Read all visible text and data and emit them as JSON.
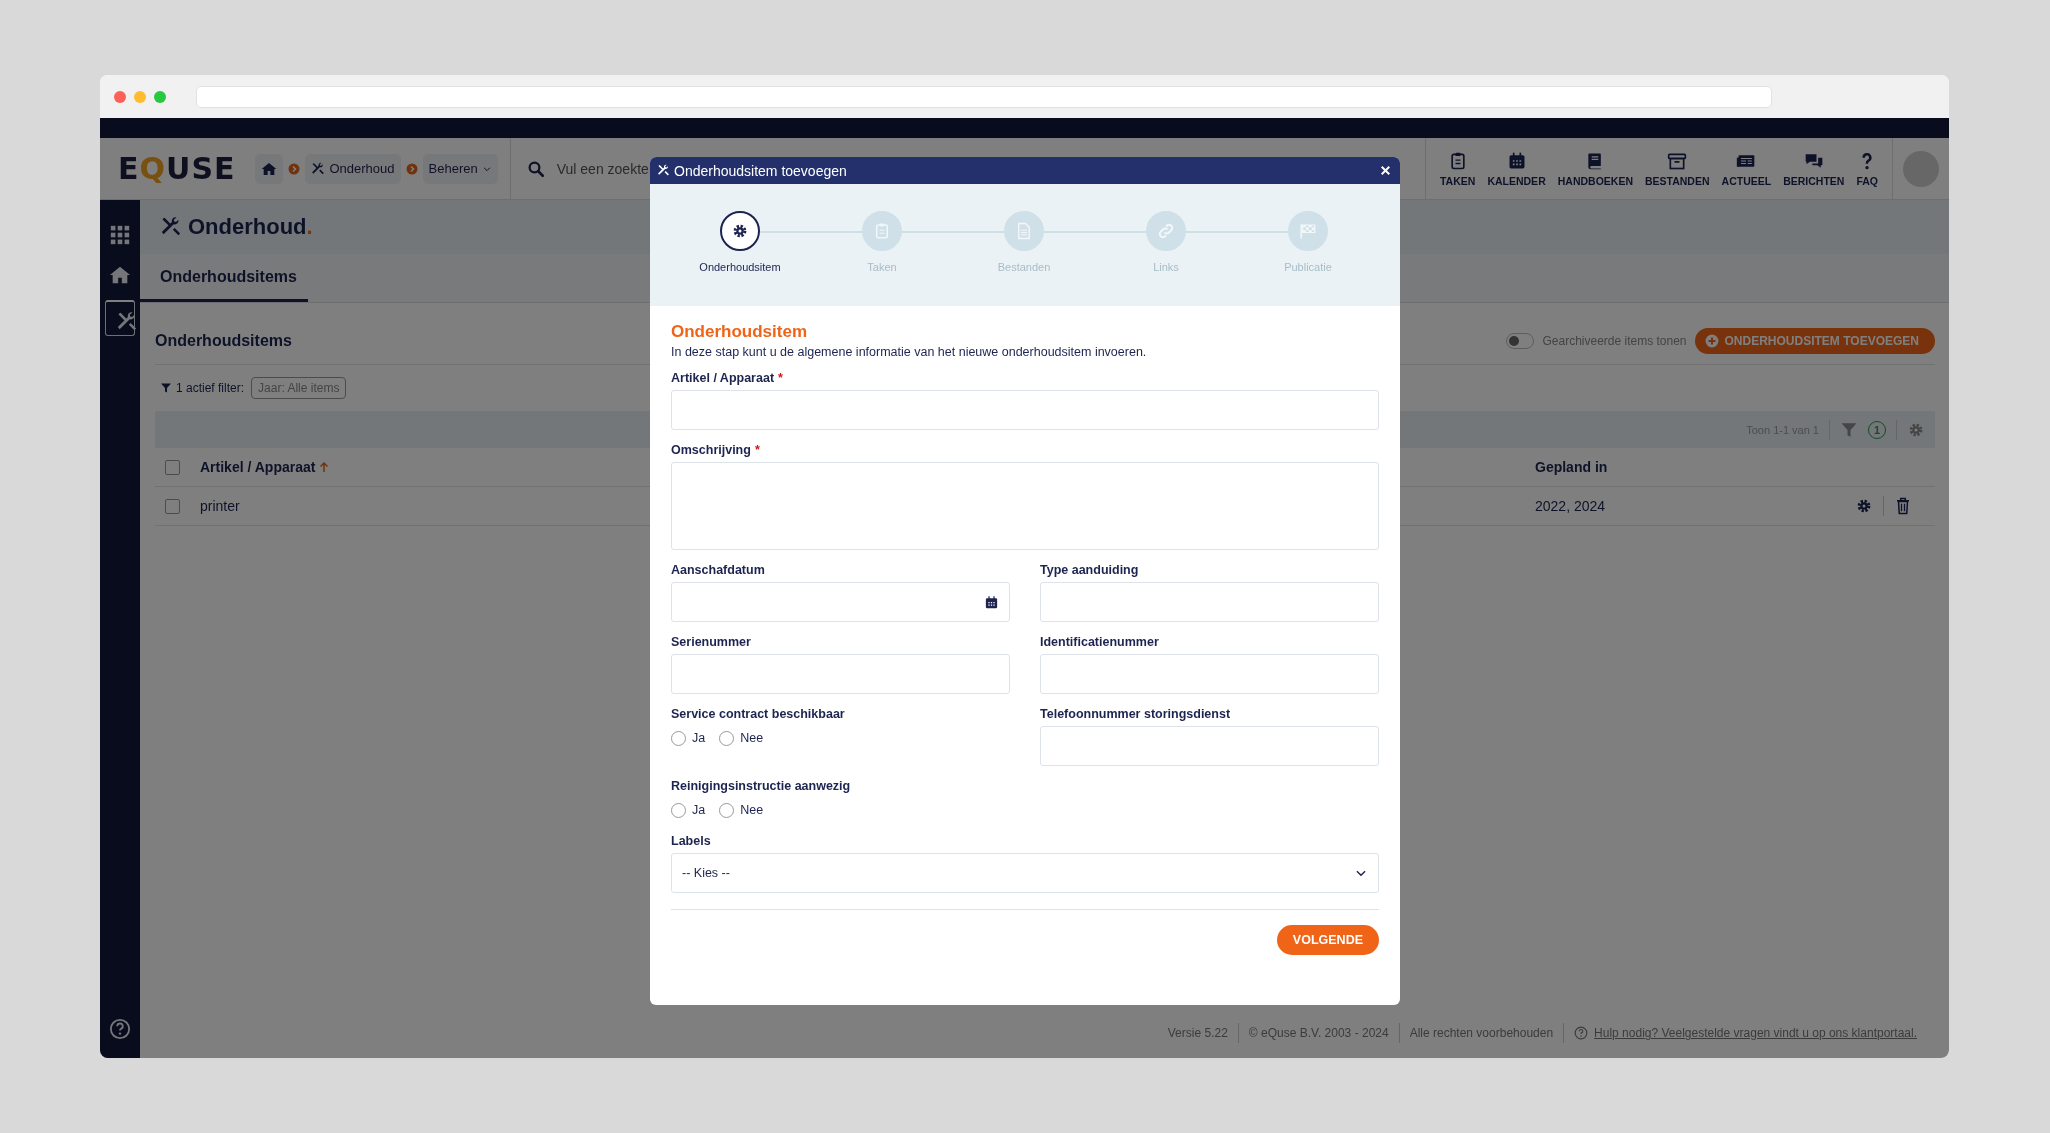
{
  "header": {
    "logo": [
      {
        "text": "E",
        "accent": false
      },
      {
        "text": "Q",
        "accent": true
      },
      {
        "text": "USE",
        "accent": false
      }
    ],
    "breadcrumbs": [
      {
        "kind": "home"
      },
      {
        "kind": "section",
        "label": "Onderhoud"
      },
      {
        "kind": "dropdown",
        "label": "Beheren"
      }
    ],
    "search": {
      "placeholder": "Vul een zoekte"
    },
    "nav": [
      {
        "label": "TAKEN",
        "kind": "clipboard"
      },
      {
        "label": "KALENDER",
        "kind": "calendar"
      },
      {
        "label": "HANDBOEKEN",
        "kind": "book"
      },
      {
        "label": "BESTANDEN",
        "kind": "archive"
      },
      {
        "label": "ACTUEEL",
        "kind": "news"
      },
      {
        "label": "BERICHTEN",
        "kind": "chat"
      },
      {
        "label": "FAQ",
        "kind": "question"
      }
    ]
  },
  "sidebar": {
    "items": [
      {
        "kind": "grid",
        "selected": false
      },
      {
        "kind": "home",
        "selected": false
      },
      {
        "kind": "tools",
        "selected": true
      }
    ]
  },
  "page": {
    "title": "Onderhoud",
    "title_mark": ".",
    "tabs": [
      {
        "label": "Onderhoudsitems",
        "selected": true
      }
    ],
    "section_title": "Onderhoudsitems",
    "archive_toggle": {
      "label": "Gearchiveerde items tonen",
      "on": false
    },
    "add_button": "ONDERHOUDSITEM TOEVOEGEN",
    "filter": {
      "label": "1 actief filter:",
      "chip": "Jaar: Alle items"
    },
    "table": {
      "count": "Toon 1-1 van 1",
      "filter_badge": "1",
      "header_checked": false,
      "columns": [
        {
          "label": "Artikel / Apparaat",
          "sorted": true
        },
        {
          "label": "Gepland in",
          "sorted": false
        }
      ],
      "rows": [
        {
          "checked": false,
          "cells": [
            "printer",
            "2022, 2024"
          ]
        }
      ]
    }
  },
  "footer": {
    "version": "Versie 5.22",
    "copyright": "© eQuse B.V. 2003 - 2024",
    "rights": "Alle rechten voorbehouden",
    "help_link": "Hulp nodig? Veelgestelde vragen vindt u op ons klantportaal."
  },
  "modal": {
    "title": "Onderhoudsitem toevoegen",
    "steps": [
      {
        "label": "Onderhoudsitem",
        "kind": "gear",
        "selected": true
      },
      {
        "label": "Taken",
        "kind": "clipboard",
        "selected": false
      },
      {
        "label": "Bestanden",
        "kind": "file",
        "selected": false
      },
      {
        "label": "Links",
        "kind": "link",
        "selected": false
      },
      {
        "label": "Publicatie",
        "kind": "flag",
        "selected": false
      }
    ],
    "section_title": "Onderhoudsitem",
    "intro": "In deze stap kunt u de algemene informatie van het nieuwe onderhoudsitem invoeren.",
    "rows": [
      [
        {
          "kind": "text",
          "label": "Artikel / Apparaat",
          "required_mark": "*"
        }
      ],
      [
        {
          "kind": "textarea",
          "label": "Omschrijving",
          "required_mark": "*"
        }
      ],
      [
        {
          "kind": "date",
          "label": "Aanschafdatum"
        },
        {
          "kind": "text",
          "label": "Type aanduiding"
        }
      ],
      [
        {
          "kind": "text",
          "label": "Serienummer"
        },
        {
          "kind": "text",
          "label": "Identificatienummer"
        }
      ],
      [
        {
          "kind": "radio",
          "label": "Service contract beschikbaar",
          "options": [
            {
              "label": "Ja",
              "selected": false
            },
            {
              "label": "Nee",
              "selected": false
            }
          ]
        },
        {
          "kind": "text",
          "label": "Telefoonnummer storingsdienst"
        }
      ],
      [
        {
          "kind": "radio",
          "label": "Reinigingsinstructie aanwezig",
          "options": [
            {
              "label": "Ja",
              "selected": false
            },
            {
              "label": "Nee",
              "selected": false
            }
          ]
        }
      ],
      [
        {
          "kind": "select",
          "label": "Labels",
          "value": "-- Kies --"
        }
      ]
    ],
    "next_button": "VOLGENDE"
  }
}
